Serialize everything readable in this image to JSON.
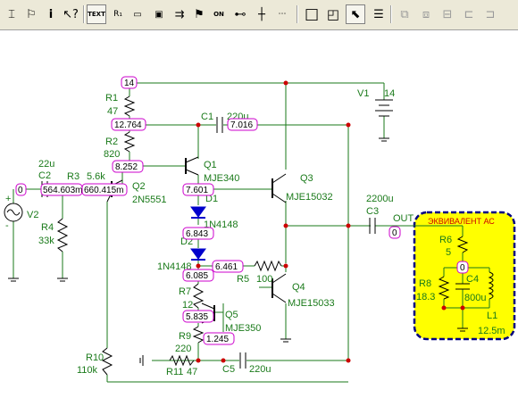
{
  "colors": {
    "wire": "#1a7a1a",
    "node_box": "#cc00cc",
    "junction": "#cc0000",
    "diode": "#0000cc",
    "speaker_fill": "#ffff00",
    "speaker_border": "#000080"
  },
  "toolbar": {
    "icons": [
      "text-cursor-icon",
      "flag-icon",
      "info-icon",
      "help-arrow-icon",
      "text-label-icon",
      "resistor-label-icon",
      "component-name-icon",
      "value-icon",
      "wire-arrows-icon",
      "node-flag-icon",
      "on-switch-icon",
      "bus-icon",
      "cross-icon",
      "grid-icon",
      "rectangle-icon",
      "frame-icon",
      "pointer-icon",
      "properties-icon",
      "group-icon",
      "ungroup-icon",
      "align-icon",
      "align-left-icon",
      "align-right-icon"
    ],
    "text_button": "TEXT",
    "on_button": "ON"
  },
  "nodes": {
    "n14": "14",
    "n12764": "12.764",
    "n7016": "7.016",
    "n8252": "8.252",
    "n0a": "0",
    "n564": "564.603m",
    "n660": "660.415m",
    "n7601": "7.601",
    "n6843": "6.843",
    "n6461": "6.461",
    "n6085": "6.085",
    "n5835": "5.835",
    "n1245": "1.245",
    "n0out": "0",
    "n0spk": "0"
  },
  "labels": {
    "r1": "R1",
    "r1v": "47",
    "r2": "R2",
    "r2v": "820",
    "c1": "C1",
    "c1v": "220u",
    "q1": "Q1",
    "q1m": "MJE340",
    "c2v": "22u",
    "c2": "C2",
    "r3": "R3",
    "r3v": "5.6k",
    "q2": "Q2",
    "q2m": "2N5551",
    "v2": "V2",
    "r4": "R4",
    "r4v": "33k",
    "d1": "D1",
    "d1m": "1N4148",
    "d2": "D2",
    "d2m": "1N4148",
    "r7": "R7",
    "r7v": "12",
    "r5": "R5",
    "r5v": "100",
    "q5": "Q5",
    "q5m": "MJE350",
    "r9": "R9",
    "r9v": "220",
    "r10": "R10",
    "r10v": "110k",
    "r11": "R11",
    "r11v": "47",
    "c5": "C5",
    "c5v": "220u",
    "q3": "Q3",
    "q3m": "MJE15032",
    "q4": "Q4",
    "q4m": "MJE15033",
    "v1": "V1",
    "v1v": "14",
    "c3v": "2200u",
    "c3": "C3",
    "out": "OUT",
    "plus": "+",
    "minus": "-"
  },
  "speaker": {
    "title": "ЭКВИВАЛЕНТ АС",
    "r6": "R6",
    "r6v": "5",
    "r8": "R8",
    "r8v": "18.3",
    "c4": "C4",
    "c4v": "800u",
    "l1": "L1",
    "l1v": "12.5m"
  }
}
